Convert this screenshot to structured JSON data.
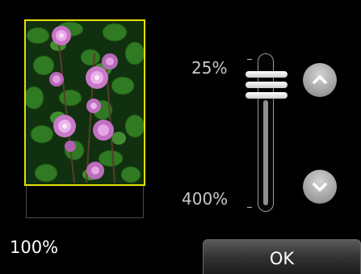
{
  "zoom": {
    "current_value": "100%",
    "slider_top_label": "25%",
    "slider_bottom_label": "400%",
    "slider_position_fraction": 0.12
  },
  "buttons": {
    "ok_label": "OK",
    "increase_icon": "chevron-up-icon",
    "decrease_icon": "chevron-down-icon"
  },
  "preview": {
    "description_icon": "photo-thumbnail",
    "selection_color": "#e6e000"
  }
}
